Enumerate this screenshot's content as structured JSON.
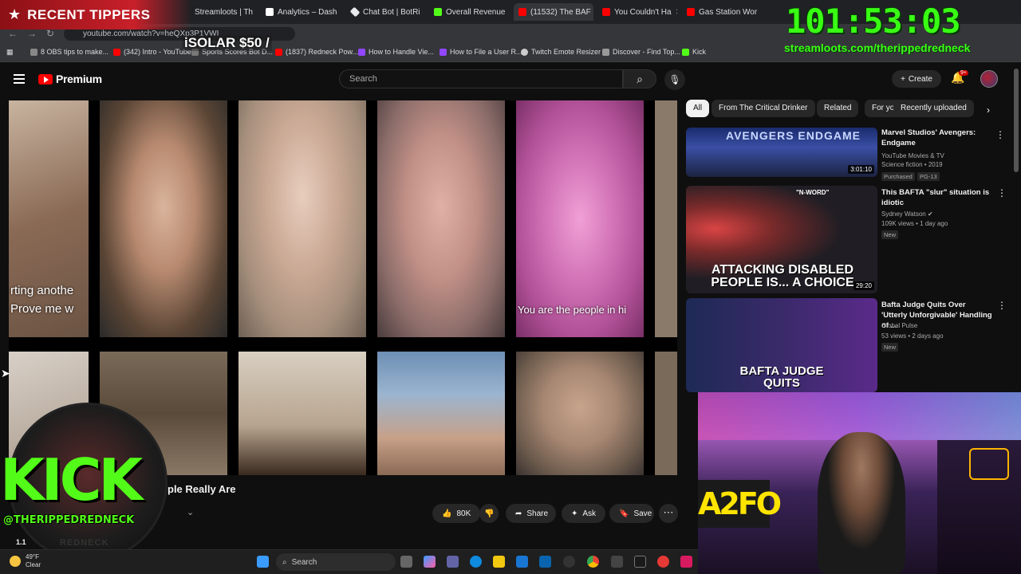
{
  "browser": {
    "tabs": [
      {
        "label": "Streamloots | Th"
      },
      {
        "label": "Analytics – Dash"
      },
      {
        "label": "Chat Bot | BotRi"
      },
      {
        "label": "Overall Revenue"
      },
      {
        "label": "(11532) The BAF"
      },
      {
        "label": "You Couldn't Ha"
      },
      {
        "label": "Gas Station Wor"
      }
    ],
    "url": "youtube.com/watch?v=heQXp3P1VWI",
    "bookmarks": [
      {
        "label": "8 OBS tips to make..."
      },
      {
        "label": "(342) Intro - YouTube"
      },
      {
        "label": "Sports Scores Bot D..."
      },
      {
        "label": "(1837) Redneck Pow..."
      },
      {
        "label": "How to Handle Vie..."
      },
      {
        "label": "How to File a User R..."
      },
      {
        "label": "Twitch Emote Resizer"
      },
      {
        "label": "Discover - Find Top..."
      },
      {
        "label": "Kick"
      }
    ]
  },
  "youtube": {
    "logo_text": "Premium",
    "search_placeholder": "Search",
    "create_label": "Create",
    "notification_count": "9+",
    "video": {
      "captions": [
        "rting anothe",
        "Prove me w",
        "You are the people in hi"
      ],
      "title_visible": "ple Really Are",
      "views_partial": "1.1",
      "likes": "80K",
      "share_label": "Share",
      "ask_label": "Ask",
      "save_label": "Save"
    },
    "chips": [
      "All",
      "From The Critical Drinker",
      "Related",
      "For you",
      "Recently uploaded"
    ],
    "recommendations": [
      {
        "title": "Marvel Studios' Avengers: Endgame",
        "channel": "YouTube Movies & TV",
        "meta": "Science fiction • 2019",
        "badges": [
          "Purchased",
          "PG-13"
        ],
        "duration": "3:01:10",
        "thumb_text": "AVENGERS ENDGAME"
      },
      {
        "title": "This BAFTA \"slur\" situation is idiotic",
        "channel": "Sydney Watson",
        "meta": "109K views • 1 day ago",
        "badges": [
          "New"
        ],
        "duration": "29:20",
        "thumb_text": "ATTACKING DISABLED PEOPLE IS... A CHOICE",
        "thumb_tag": "\"N-WORD\""
      },
      {
        "title": "Bafta Judge Quits Over 'Utterly Unforgivable' Handling of ...",
        "channel": "Global Pulse",
        "meta": "53 views • 2 days ago",
        "badges": [
          "New"
        ],
        "duration": "",
        "thumb_text": "BAFTA JUDGE QUITS"
      }
    ]
  },
  "overlay": {
    "recent_tippers": "RECENT TIPPERS",
    "tipper": "iSOLAR $50 /",
    "timer": "101:53:03",
    "url": "streamloots.com/therippedredneck",
    "kick_text": "KICK",
    "kick_handle": "@THERIPPEDREDNECK",
    "kick_sub": "REDNECK",
    "webcam_sign": "A2FO"
  },
  "taskbar": {
    "temperature": "49°F",
    "condition": "Clear",
    "search_label": "Search"
  },
  "colors": {
    "yt_bg": "#0f0f0f",
    "yt_red": "#ff0000",
    "kick_green": "#53fc18",
    "timer_green": "#39ff14",
    "tipper_red": "#c8202a"
  }
}
